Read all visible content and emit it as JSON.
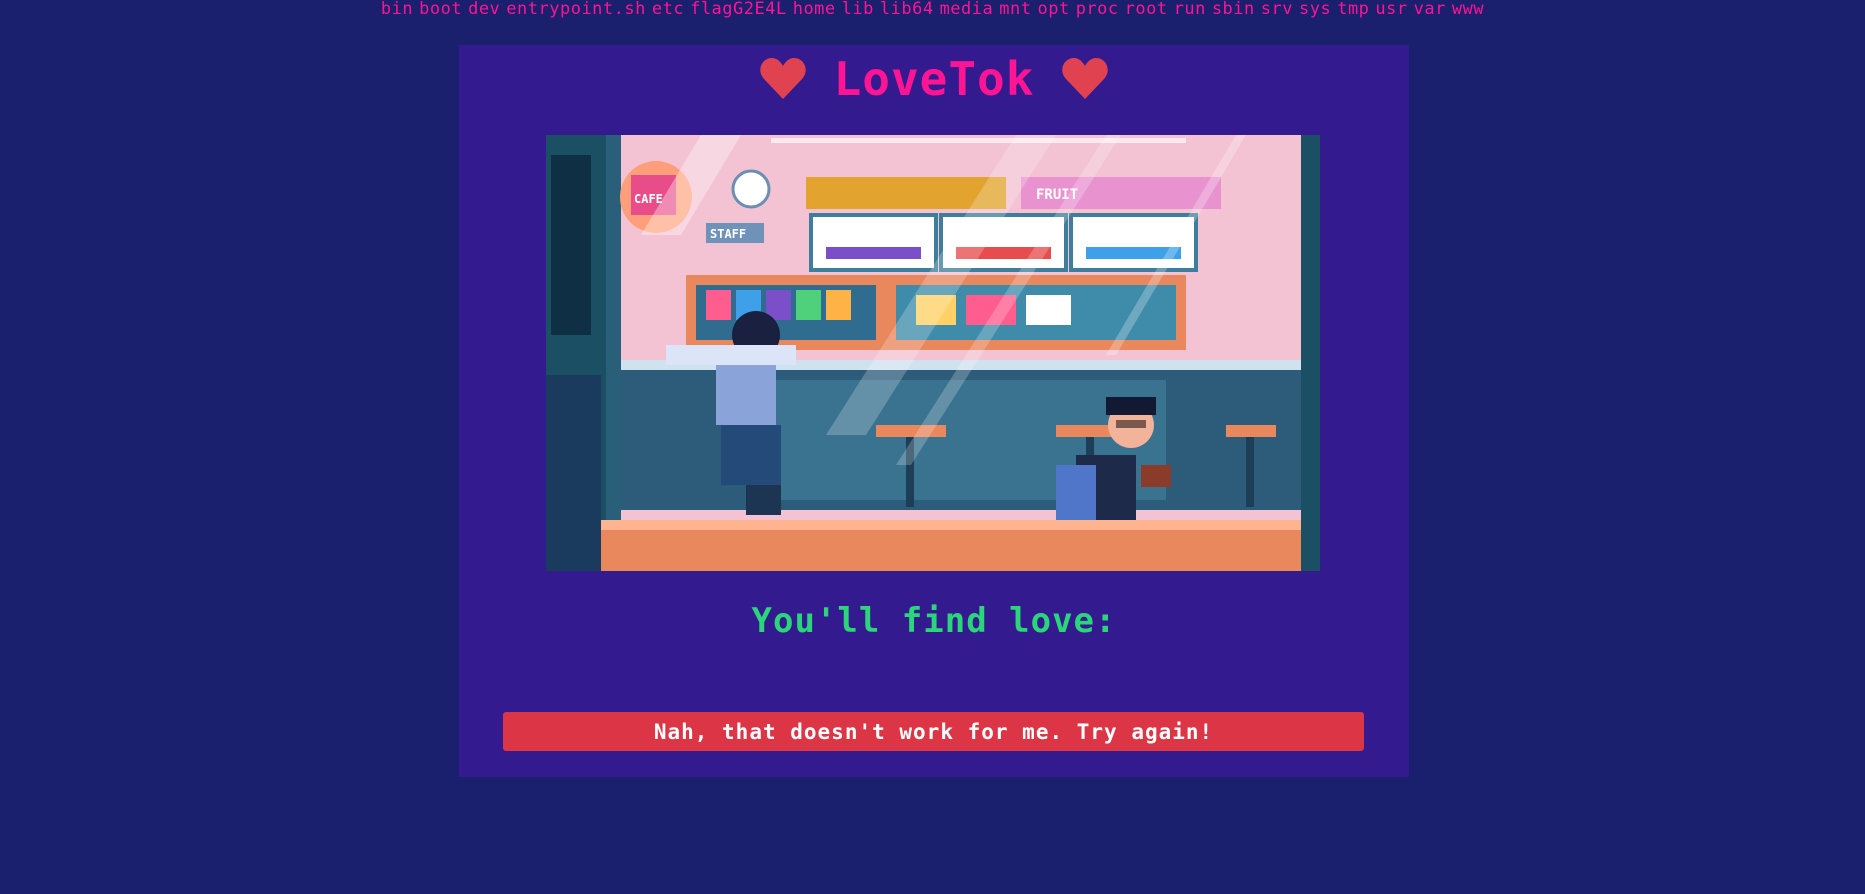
{
  "directory_listing": [
    "bin",
    "boot",
    "dev",
    "entrypoint.sh",
    "etc",
    "flagG2E4L",
    "home",
    "lib",
    "lib64",
    "media",
    "mnt",
    "opt",
    "proc",
    "root",
    "run",
    "sbin",
    "srv",
    "sys",
    "tmp",
    "usr",
    "var",
    "www"
  ],
  "header": {
    "title": "LoveTok",
    "left_icon": "heart-icon",
    "right_icon": "heart-icon"
  },
  "scene": {
    "icon": "pixel-art-cafe-scene",
    "sign_left": "CAFE",
    "sign_staff": "STAFF",
    "sign_fruit": "FRUIT"
  },
  "main": {
    "subtitle": "You'll find love:",
    "result_text": ""
  },
  "alert": {
    "message": "Nah, that doesn't work for me. Try again!"
  },
  "colors": {
    "background": "#1a1f6e",
    "card": "#331b8f",
    "accent_pink": "#ff1493",
    "heart_red": "#e0434f",
    "subtitle_green": "#2bd67b",
    "alert_red": "#dc3545"
  }
}
